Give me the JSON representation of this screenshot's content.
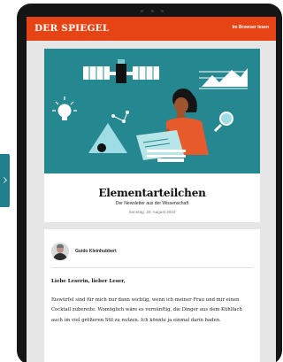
{
  "header": {
    "logo": "DER SPIEGEL",
    "browser_link": "Im Browser lesen"
  },
  "newsletter": {
    "title": "Elementarteilchen",
    "subtitle": "Der Newsletter aus der Wissenschaft",
    "date": "Sonntag, 20. August 2023"
  },
  "author": {
    "name": "Guido Kleinhubbert"
  },
  "content": {
    "greeting": "Liebe Leserin, lieber Leser,",
    "paragraph": "Eiswürfel sind für mich nur dann wichtig, wenn ich meiner Frau und mir einen Cocktail zubereite. Womöglich wäre es vernünftig, die Dinger aus dem Kühlfach auch im viel größeren Stil zu nutzen. Ich könnte ja einmal darin baden."
  },
  "colors": {
    "brand": "#e64415",
    "hero_background": "#25878f",
    "side_tab": "#1f7f8c"
  }
}
